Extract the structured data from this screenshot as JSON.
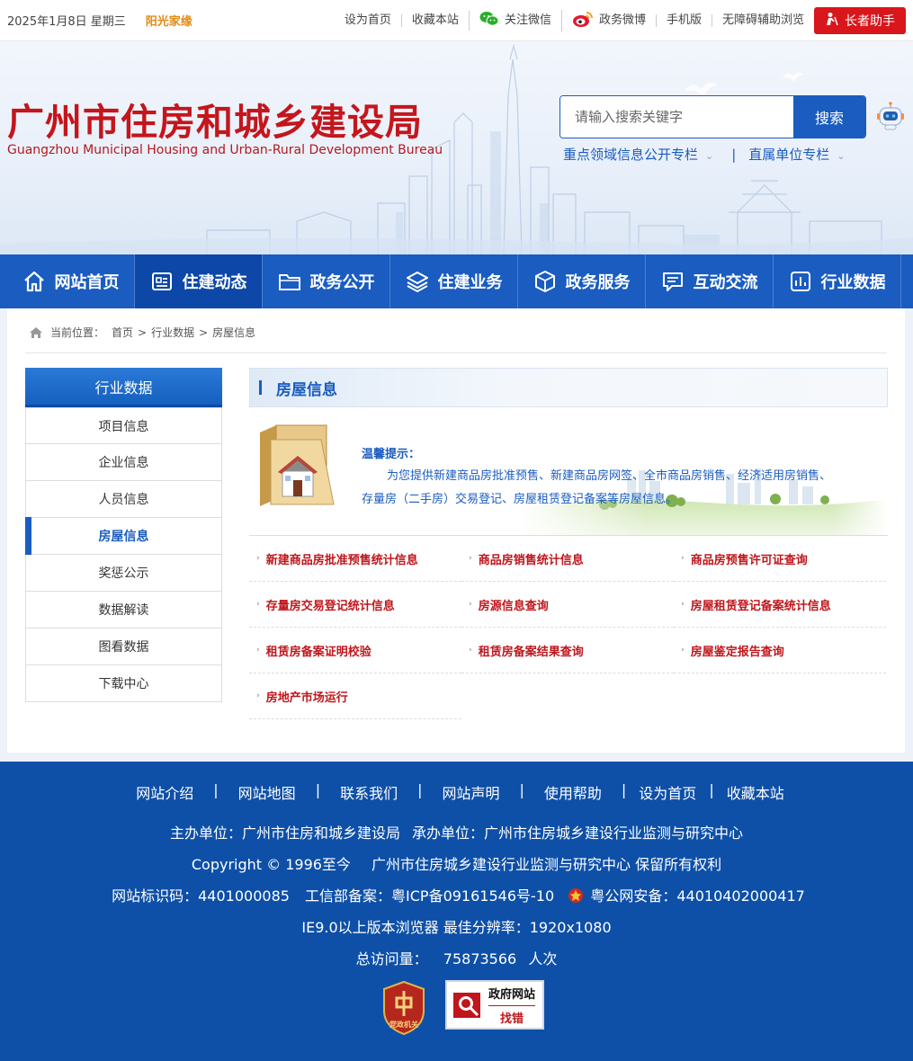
{
  "topbar": {
    "date": "2025年1月8日 星期三",
    "sunshine": "阳光家缘",
    "links": [
      "设为首页",
      "收藏本站",
      "关注微信",
      "政务微博",
      "手机版",
      "无障碍辅助浏览"
    ],
    "elder_button": "长者助手"
  },
  "header": {
    "title": "广州市住房和城乡建设局",
    "title_en": "Guangzhou Municipal Housing and Urban-Rural Development Bureau",
    "search_placeholder": "请输入搜索关键字",
    "search_button": "搜索",
    "special_1": "重点领域信息公开专栏",
    "special_2": "直属单位专栏",
    "special_sep": "|"
  },
  "nav": [
    "网站首页",
    "住建动态",
    "政务公开",
    "住建业务",
    "政务服务",
    "互动交流",
    "行业数据"
  ],
  "breadcrumb": {
    "label": "当前位置：",
    "items": [
      "首页",
      "行业数据",
      "房屋信息"
    ],
    "sep": ">"
  },
  "sidebar": {
    "title": "行业数据",
    "items": [
      "项目信息",
      "企业信息",
      "人员信息",
      "房屋信息",
      "奖惩公示",
      "数据解读",
      "图看数据",
      "下载中心"
    ],
    "active_index": 3
  },
  "content": {
    "title": "房屋信息",
    "tip_title": "温馨提示：",
    "tip_text": "为您提供新建商品房批准预售、新建商品房网签、全市商品房销售、经济适用房销售、存量房（二手房）交易登记、房屋租赁登记备案等房屋信息。",
    "links": [
      "新建商品房批准预售统计信息",
      "商品房销售统计信息",
      "商品房预售许可证查询",
      "存量房交易登记统计信息",
      "房源信息查询",
      "房屋租赁登记备案统计信息",
      "租赁房备案证明校验",
      "租赁房备案结果查询",
      "房屋鉴定报告查询",
      "房地产市场运行"
    ]
  },
  "footer": {
    "links": [
      "网站介绍",
      "网站地图",
      "联系我们",
      "网站声明",
      "使用帮助",
      "设为首页",
      "收藏本站"
    ],
    "sep": "|",
    "sponsor": "主办单位：广州市住房和城乡建设局",
    "organizer": "承办单位：广州市住房城乡建设行业监测与研究中心",
    "copyright": "Copyright © 1996至今",
    "rights": "广州市住房城乡建设行业监测与研究中心 保留所有权利",
    "site_code": "网站标识码：4401000085",
    "icp": "工信部备案：粤ICP备09161546号-10",
    "police": "粤公网安备：44010402000417",
    "browser": "IE9.0以上版本浏览器 最佳分辨率：1920x1080",
    "visits_label": "总访问量：",
    "visits": "75873566",
    "visits_unit": "人次",
    "badge1": "党政机关",
    "badge2_line1": "政府网站",
    "badge2_line2": "找错"
  },
  "colors": {
    "brand_blue": "#1a5cc0",
    "nav_active": "#0d47a7",
    "title_red": "#c4161c",
    "footer_bg": "#0e50a8"
  }
}
